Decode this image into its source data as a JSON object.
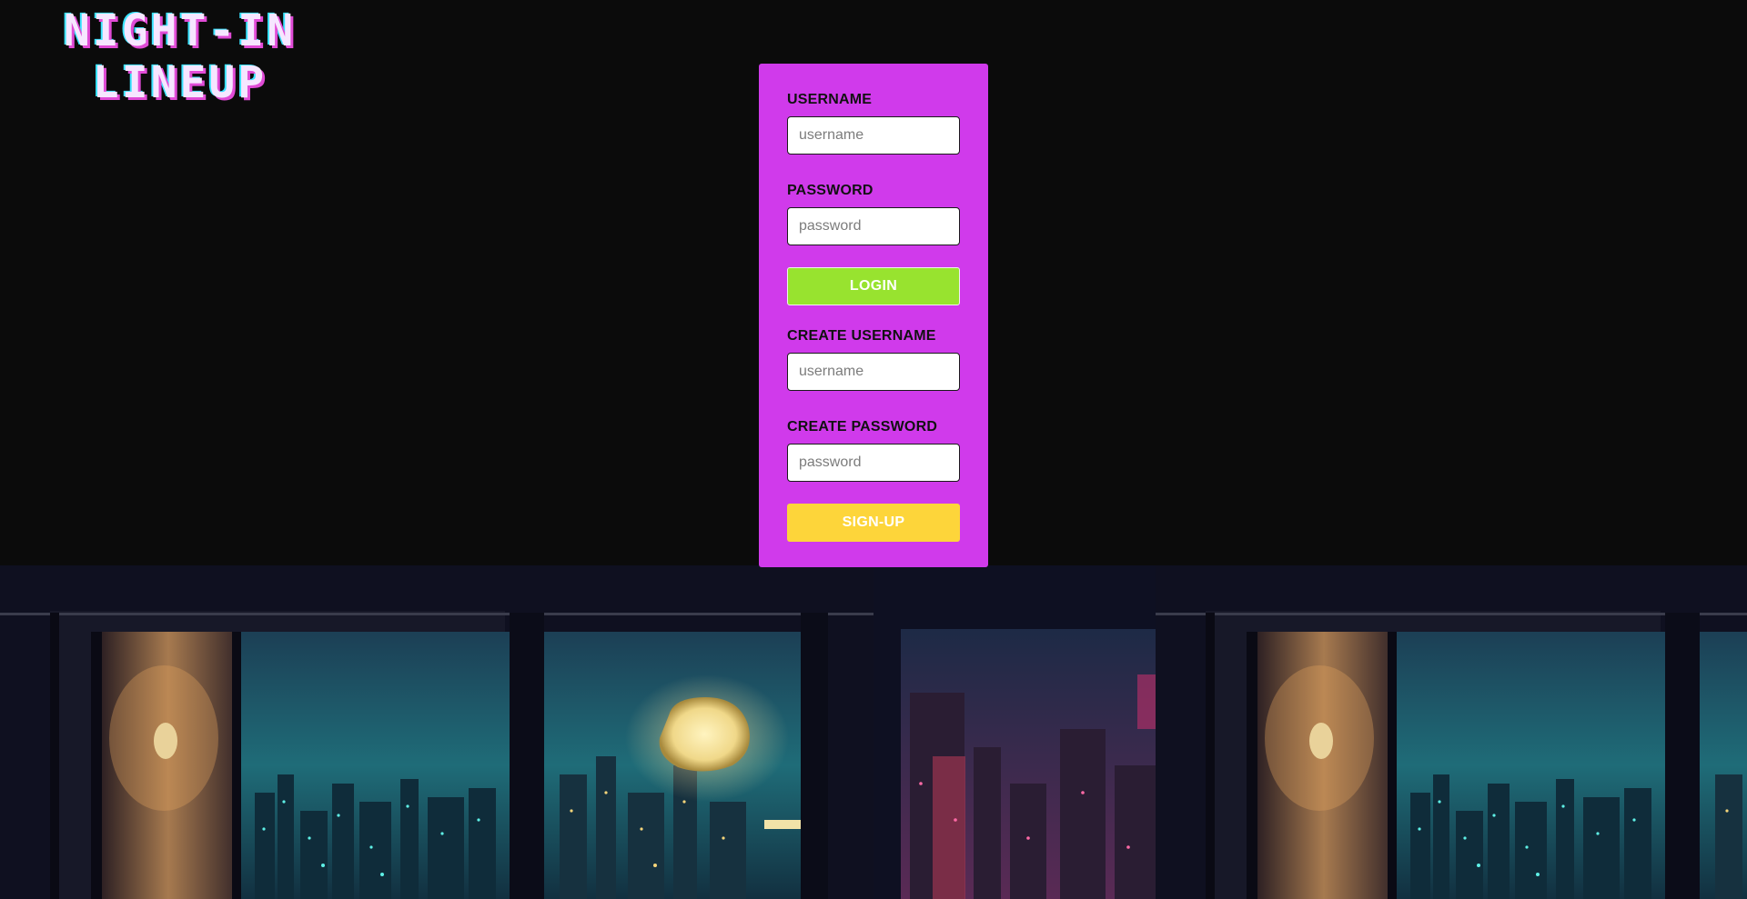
{
  "logo": {
    "line1": "NIGHT-IN",
    "line2": "LINEUP"
  },
  "login": {
    "username_label": "USERNAME",
    "username_placeholder": "username",
    "username_value": "",
    "password_label": "PASSWORD",
    "password_placeholder": "password",
    "password_value": "",
    "button_label": "LOGIN"
  },
  "signup": {
    "username_label": "CREATE USERNAME",
    "username_placeholder": "username",
    "username_value": "",
    "password_label": "CREATE PASSWORD",
    "password_placeholder": "password",
    "password_value": "",
    "button_label": "SIGN-UP"
  },
  "colors": {
    "page_background": "#0b0b0b",
    "card_background": "#d03aeb",
    "login_button": "#98e32f",
    "signup_button": "#fdd53a",
    "logo_text": "#f6e6ff",
    "logo_shadow_pink": "#e04bd6",
    "logo_shadow_cyan": "#39e3ff"
  }
}
